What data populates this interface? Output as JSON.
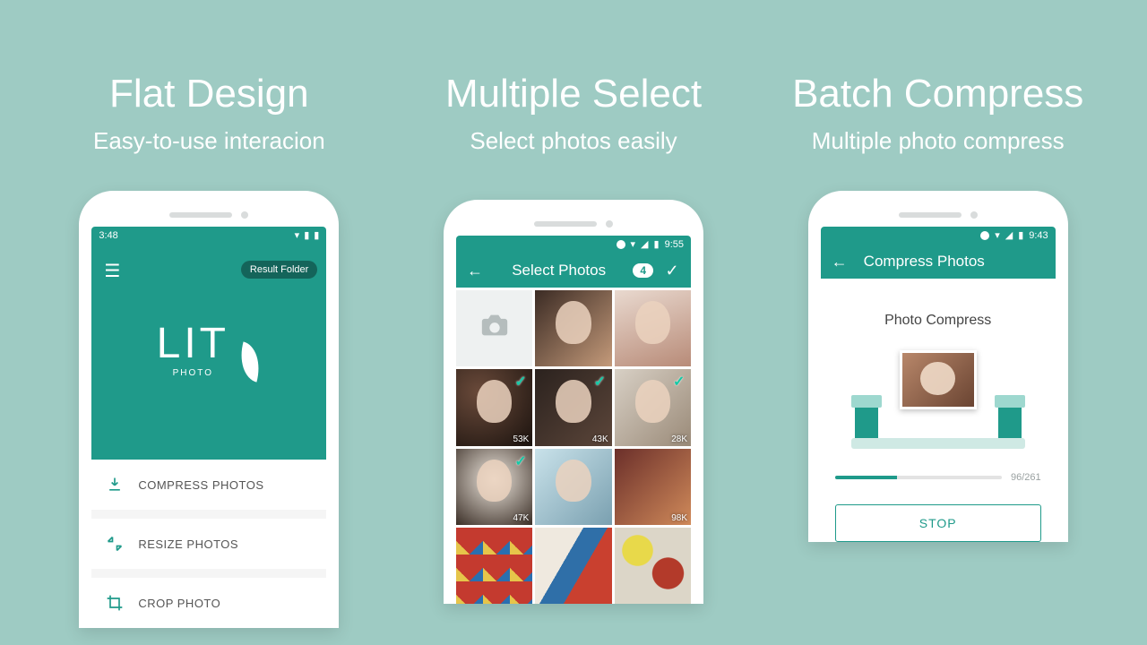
{
  "columns": [
    {
      "title": "Flat Design",
      "subtitle": "Easy-to-use interacion"
    },
    {
      "title": "Multiple Select",
      "subtitle": "Select photos easily"
    },
    {
      "title": "Batch Compress",
      "subtitle": "Multiple photo compress"
    }
  ],
  "screen1": {
    "status_time": "3:48",
    "result_pill": "Result Folder",
    "logo_main": "LIT",
    "logo_sub": "PHOTO",
    "menu": [
      {
        "label": "COMPRESS PHOTOS",
        "icon": "download"
      },
      {
        "label": "RESIZE PHOTOS",
        "icon": "collapse"
      },
      {
        "label": "CROP PHOTO",
        "icon": "crop"
      }
    ]
  },
  "screen2": {
    "status_time": "9:55",
    "appbar_title": "Select Photos",
    "selected_count": "4",
    "thumbs": [
      {
        "kind": "camera"
      },
      {
        "kind": "photo",
        "ph": "p1",
        "size": "",
        "person": true
      },
      {
        "kind": "photo",
        "ph": "p2",
        "size": "",
        "person": true
      },
      {
        "kind": "photo",
        "ph": "p3",
        "size": "53K",
        "selected": true,
        "person": true
      },
      {
        "kind": "photo",
        "ph": "p4",
        "size": "43K",
        "selected": true,
        "person": true
      },
      {
        "kind": "photo",
        "ph": "p5",
        "size": "28K",
        "selected": true,
        "person": true
      },
      {
        "kind": "photo",
        "ph": "p6",
        "size": "47K",
        "selected": true,
        "person": true
      },
      {
        "kind": "photo",
        "ph": "p7",
        "size": "",
        "person": true
      },
      {
        "kind": "photo",
        "ph": "p8",
        "size": "98K",
        "person": false
      },
      {
        "kind": "photo",
        "ph": "abstract1",
        "size": ""
      },
      {
        "kind": "photo",
        "ph": "abstract2",
        "size": ""
      },
      {
        "kind": "photo",
        "ph": "abstract3",
        "size": ""
      }
    ]
  },
  "screen3": {
    "status_time": "9:43",
    "appbar_title": "Compress Photos",
    "section_title": "Photo Compress",
    "progress_text": "96/261",
    "stop_label": "STOP"
  }
}
